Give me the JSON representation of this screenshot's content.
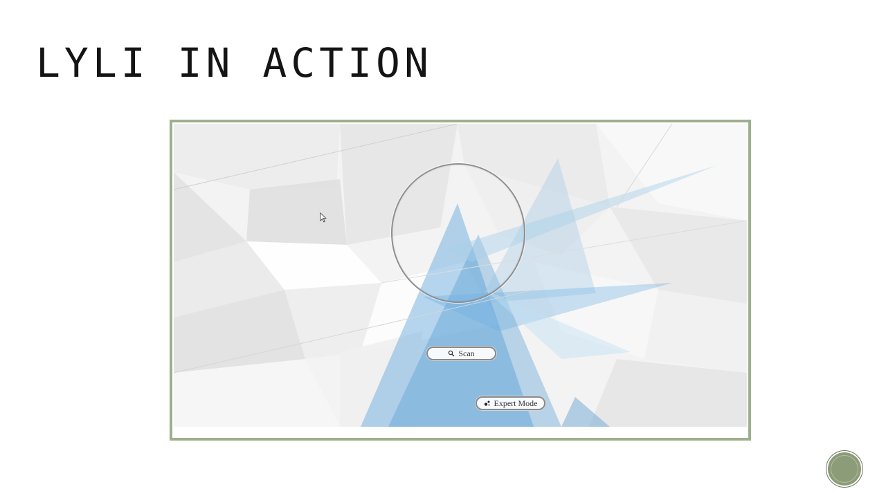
{
  "slide": {
    "title": "LYLI IN ACTION"
  },
  "app": {
    "scan_label": "Scan",
    "expert_label": "Expert Mode",
    "icons": {
      "scan": "magnifier-icon",
      "expert": "dots-icon",
      "pointer": "mouse-pointer-icon",
      "badge": "slide-number-badge"
    }
  },
  "colors": {
    "frame_border": "#9eaf8d",
    "accent_blue": "#5ea6dc",
    "badge_green": "#8c9b78"
  }
}
